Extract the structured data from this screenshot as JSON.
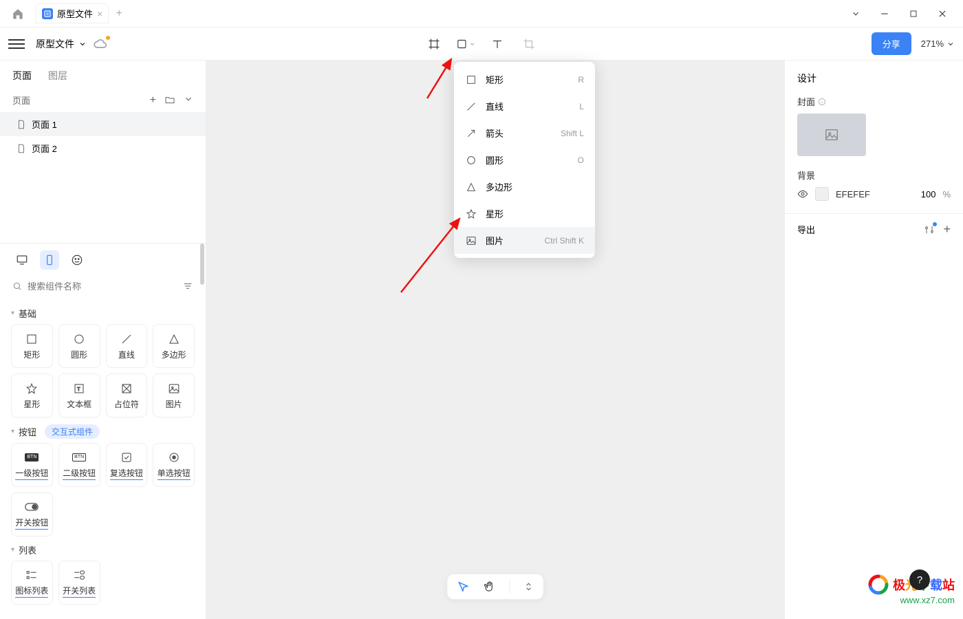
{
  "titlebar": {
    "tab_name": "原型文件"
  },
  "toolbar": {
    "file_name": "原型文件",
    "share": "分享",
    "zoom": "271%"
  },
  "left": {
    "tabs": {
      "pages": "页面",
      "layers": "图层"
    },
    "pages_label": "页面",
    "pages": [
      {
        "name": "页面 1"
      },
      {
        "name": "页面 2"
      }
    ],
    "search_placeholder": "搜索组件名称",
    "sections": {
      "basic": {
        "title": "基础",
        "items": [
          "矩形",
          "圆形",
          "直线",
          "多边形",
          "星形",
          "文本框",
          "占位符",
          "图片"
        ]
      },
      "buttons": {
        "title": "按钮",
        "pill": "交互式组件",
        "items": [
          "一级按钮",
          "二级按钮",
          "复选按钮",
          "单选按钮",
          "开关按钮"
        ]
      },
      "lists": {
        "title": "列表",
        "items": [
          "图标列表",
          "开关列表"
        ]
      }
    }
  },
  "dropdown": {
    "items": [
      {
        "icon": "rect",
        "label": "矩形",
        "shortcut": "R"
      },
      {
        "icon": "line",
        "label": "直线",
        "shortcut": "L"
      },
      {
        "icon": "arrow",
        "label": "箭头",
        "shortcut": "Shift L"
      },
      {
        "icon": "circle",
        "label": "圆形",
        "shortcut": "O"
      },
      {
        "icon": "triangle",
        "label": "多边形",
        "shortcut": ""
      },
      {
        "icon": "star",
        "label": "星形",
        "shortcut": ""
      },
      {
        "icon": "image",
        "label": "图片",
        "shortcut": "Ctrl Shift K"
      }
    ]
  },
  "right": {
    "design": "设计",
    "cover": "封面",
    "background": "背景",
    "bg_hex": "EFEFEF",
    "bg_opacity": "100",
    "percent": "%",
    "export": "导出"
  },
  "watermark": {
    "text": "极光下载站",
    "url": "www.xz7.com"
  }
}
